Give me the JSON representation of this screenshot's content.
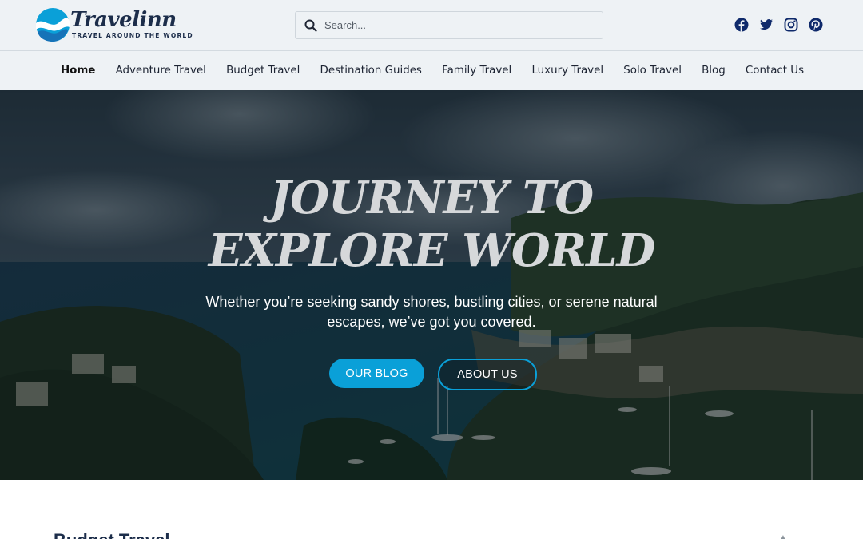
{
  "brand": {
    "name": "Travelinn",
    "tagline": "TRAVEL AROUND THE WORLD",
    "accent_color": "#0aa0d8",
    "logo_icon": "wave-globe-icon"
  },
  "search": {
    "placeholder": "Search...",
    "value": "",
    "icon": "search-icon"
  },
  "social": [
    {
      "name": "facebook-icon"
    },
    {
      "name": "twitter-icon"
    },
    {
      "name": "instagram-icon"
    },
    {
      "name": "pinterest-icon"
    }
  ],
  "nav": {
    "items": [
      {
        "label": "Home",
        "active": true
      },
      {
        "label": "Adventure Travel"
      },
      {
        "label": "Budget Travel"
      },
      {
        "label": "Destination Guides"
      },
      {
        "label": "Family Travel"
      },
      {
        "label": "Luxury Travel"
      },
      {
        "label": "Solo Travel"
      },
      {
        "label": "Blog"
      },
      {
        "label": "Contact Us"
      }
    ]
  },
  "hero": {
    "title_line1": "JOURNEY TO",
    "title_line2": "EXPLORE WORLD",
    "subtitle": "Whether you’re seeking sandy shores, bustling cities, or serene natural escapes, we’ve got you covered.",
    "primary_button": "OUR BLOG",
    "secondary_button": "ABOUT US"
  },
  "section": {
    "heading": "Budget Travel"
  }
}
